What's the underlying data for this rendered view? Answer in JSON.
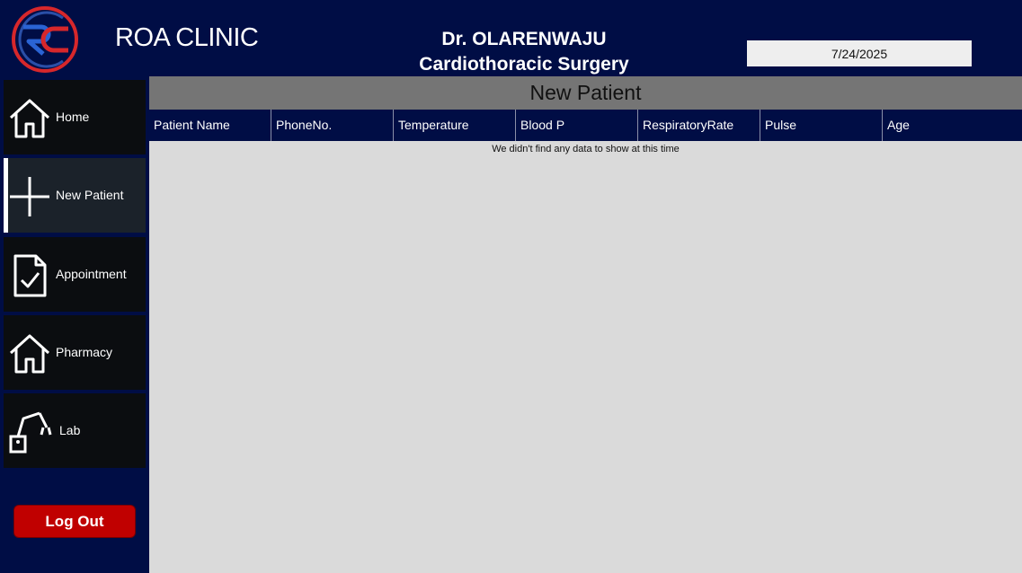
{
  "header": {
    "clinic_name": "ROA CLINIC",
    "doctor_name": "Dr. OLARENWAJU",
    "specialty": "Cardiothoracic Surgery",
    "date": "7/24/2025",
    "logo_icon": "rc-logo-icon"
  },
  "sidebar": {
    "items": [
      {
        "label": "Home",
        "icon": "house-icon"
      },
      {
        "label": "New Patient",
        "icon": "plus-icon",
        "active": true
      },
      {
        "label": "Appointment",
        "icon": "document-check-icon"
      },
      {
        "label": "Pharmacy",
        "icon": "house-icon"
      },
      {
        "label": "Lab",
        "icon": "robot-arm-icon"
      }
    ],
    "logout_label": "Log Out"
  },
  "main": {
    "title": "New Patient",
    "columns": [
      "Patient Name",
      "PhoneNo.",
      "Temperature",
      "Blood P",
      "RespiratoryRate",
      "Pulse",
      "Age"
    ],
    "empty_message": "We didn't find any data to show at this time"
  },
  "colors": {
    "navy": "#000d45",
    "sidebar_item": "#0b0d10",
    "sidebar_active": "#1b222a",
    "logout_red": "#c00000",
    "title_bar_gray": "#757575",
    "content_gray": "#dadada"
  }
}
